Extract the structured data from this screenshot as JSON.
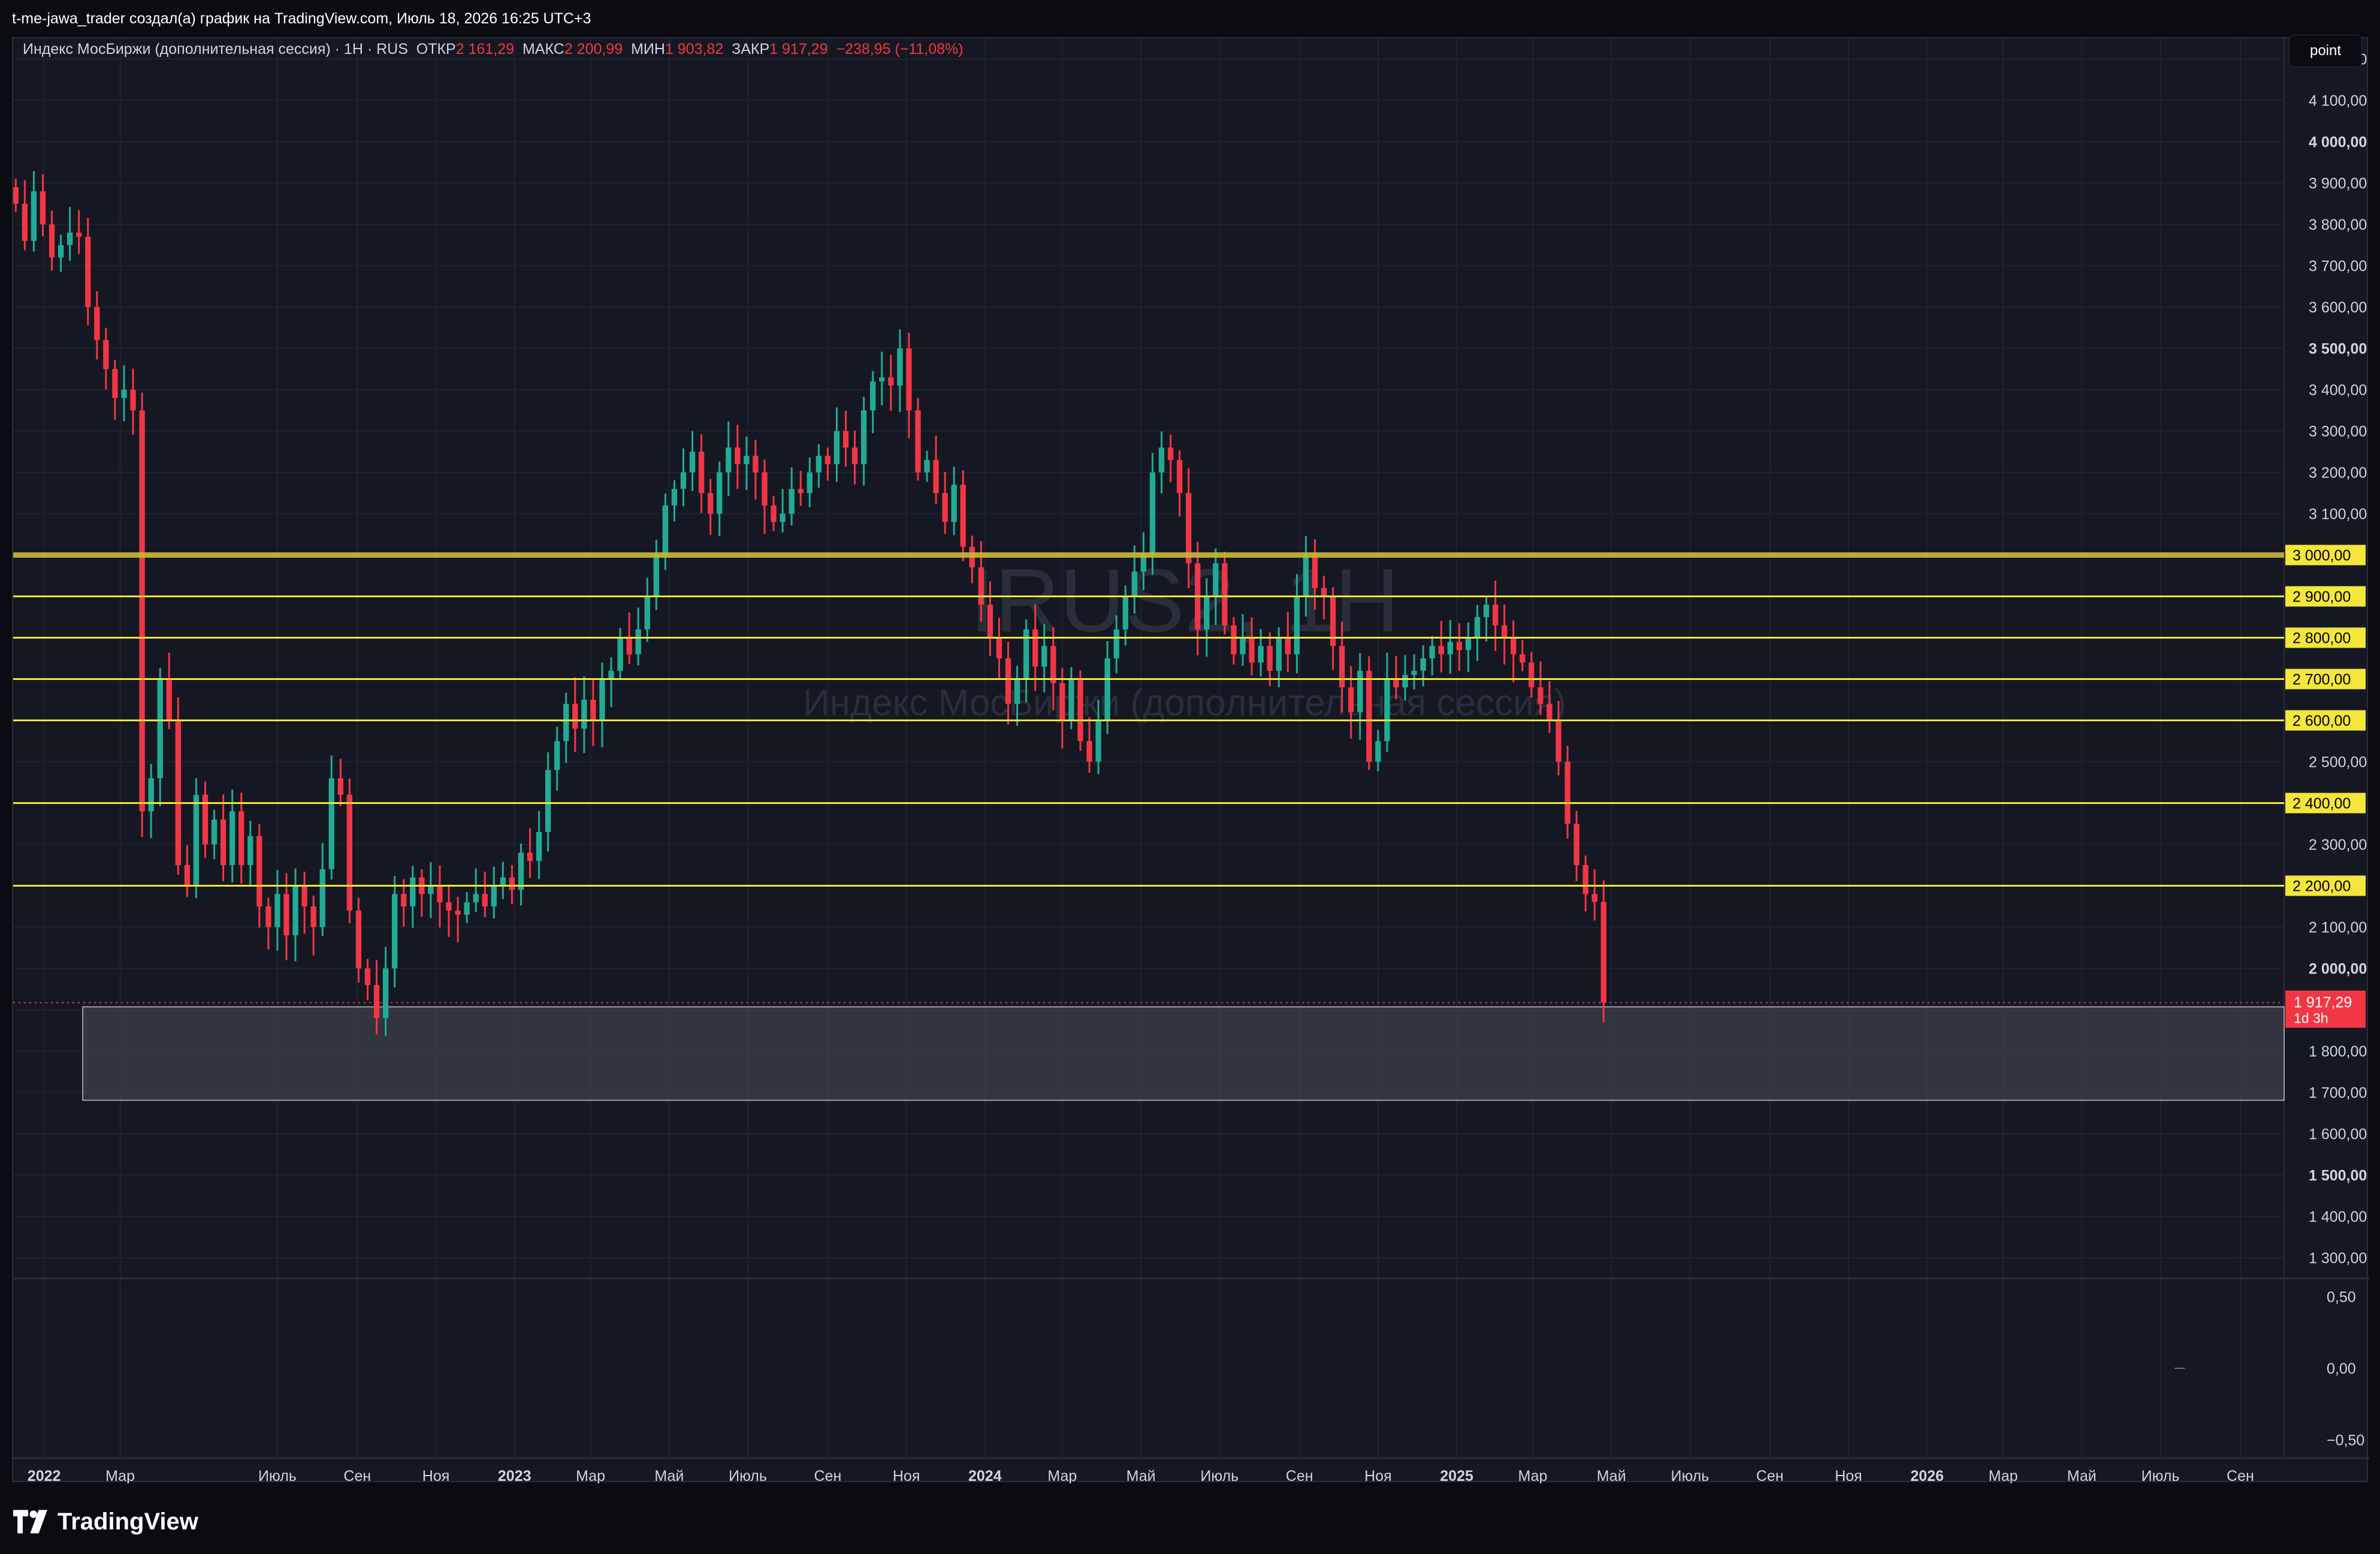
{
  "header": {
    "attribution": "t-me-jawa_trader создал(а) график на TradingView.com, Июль 18, 2026 16:25 UTC+3"
  },
  "legend": {
    "symbol": "Индекс МосБиржи (дополнительная сессия) · 1H · RUS",
    "open_label": "ОТКР",
    "open_value": "2 161,29",
    "high_label": "МАКС",
    "high_value": "2 200,99",
    "low_label": "МИН",
    "low_value": "1 903,82",
    "close_label": "ЗАКР",
    "close_value": "1 917,29",
    "change": "−238,95 (−11,08%)"
  },
  "toolbar": {
    "point_label": "point"
  },
  "watermark": {
    "ticker": "IRUS2, 1H",
    "name": "Индекс МосБиржи (дополнительная сессия)"
  },
  "footer": {
    "brand": "TradingView"
  },
  "colors": {
    "up": "#22ab94",
    "down": "#f23645",
    "level": "#f5e63b",
    "background": "#151822",
    "grid": "#1f2330",
    "zone": "#4a4d55"
  },
  "chart_data": {
    "type": "candlestick",
    "price_axis": {
      "range": [
        1250,
        4250
      ],
      "ticks": [
        {
          "v": 4200,
          "t": "4 200,00"
        },
        {
          "v": 4100,
          "t": "4 100,00"
        },
        {
          "v": 4000,
          "t": "4 000,00",
          "b": true
        },
        {
          "v": 3900,
          "t": "3 900,00"
        },
        {
          "v": 3800,
          "t": "3 800,00"
        },
        {
          "v": 3700,
          "t": "3 700,00"
        },
        {
          "v": 3600,
          "t": "3 600,00"
        },
        {
          "v": 3500,
          "t": "3 500,00",
          "b": true
        },
        {
          "v": 3400,
          "t": "3 400,00"
        },
        {
          "v": 3300,
          "t": "3 300,00"
        },
        {
          "v": 3200,
          "t": "3 200,00"
        },
        {
          "v": 3100,
          "t": "3 100,00"
        },
        {
          "v": 2500,
          "t": "2 500,00"
        },
        {
          "v": 2300,
          "t": "2 300,00"
        },
        {
          "v": 2100,
          "t": "2 100,00"
        },
        {
          "v": 2000,
          "t": "2 000,00",
          "b": true
        },
        {
          "v": 1800,
          "t": "1 800,00"
        },
        {
          "v": 1700,
          "t": "1 700,00"
        },
        {
          "v": 1600,
          "t": "1 600,00"
        },
        {
          "v": 1500,
          "t": "1 500,00",
          "b": true
        },
        {
          "v": 1400,
          "t": "1 400,00"
        },
        {
          "v": 1300,
          "t": "1 300,00"
        }
      ]
    },
    "levels": [
      {
        "value": 3000,
        "label": "3 000,00",
        "thick": true
      },
      {
        "value": 2900,
        "label": "2 900,00"
      },
      {
        "value": 2800,
        "label": "2 800,00"
      },
      {
        "value": 2700,
        "label": "2 700,00"
      },
      {
        "value": 2600,
        "label": "2 600,00"
      },
      {
        "value": 2400,
        "label": "2 400,00"
      },
      {
        "value": 2200,
        "label": "2 200,00"
      }
    ],
    "current_price": {
      "value": 1917.29,
      "label": "1 917,29",
      "countdown": "1d 3h"
    },
    "zone": {
      "from_date": "2022-01-31",
      "low": 1681,
      "high": 1907
    },
    "indicator": {
      "ticks": [
        {
          "v": 0.5,
          "t": "0,50"
        },
        {
          "v": 0.0,
          "t": "0,00"
        },
        {
          "v": -0.5,
          "t": "−0,50"
        }
      ],
      "range": [
        -0.62,
        0.62
      ]
    },
    "time_axis": {
      "start": "2021-12-08",
      "end": "2026-10-05",
      "labels": [
        {
          "d": "2022-01-01",
          "t": "2022",
          "b": true
        },
        {
          "d": "2022-03-01",
          "t": "Мар"
        },
        {
          "d": "2022-07-01",
          "t": "Июль"
        },
        {
          "d": "2022-09-01",
          "t": "Сен"
        },
        {
          "d": "2022-11-01",
          "t": "Ноя"
        },
        {
          "d": "2023-01-01",
          "t": "2023",
          "b": true
        },
        {
          "d": "2023-03-01",
          "t": "Мар"
        },
        {
          "d": "2023-05-01",
          "t": "Май"
        },
        {
          "d": "2023-07-01",
          "t": "Июль"
        },
        {
          "d": "2023-09-01",
          "t": "Сен"
        },
        {
          "d": "2023-11-01",
          "t": "Ноя"
        },
        {
          "d": "2024-01-01",
          "t": "2024",
          "b": true
        },
        {
          "d": "2024-03-01",
          "t": "Мар"
        },
        {
          "d": "2024-05-01",
          "t": "Май"
        },
        {
          "d": "2024-07-01",
          "t": "Июль"
        },
        {
          "d": "2024-09-01",
          "t": "Сен"
        },
        {
          "d": "2024-11-01",
          "t": "Ноя"
        },
        {
          "d": "2025-01-01",
          "t": "2025",
          "b": true
        },
        {
          "d": "2025-03-01",
          "t": "Мар"
        },
        {
          "d": "2025-05-01",
          "t": "Май"
        },
        {
          "d": "2025-07-01",
          "t": "Июль"
        },
        {
          "d": "2025-09-01",
          "t": "Сен"
        },
        {
          "d": "2025-11-01",
          "t": "Ноя"
        },
        {
          "d": "2026-01-01",
          "t": "2026",
          "b": true
        },
        {
          "d": "2026-03-01",
          "t": "Мар"
        },
        {
          "d": "2026-05-01",
          "t": "Май"
        },
        {
          "d": "2026-07-01",
          "t": "Июль"
        },
        {
          "d": "2026-09-01",
          "t": "Сен"
        }
      ]
    },
    "first_date": "2021-12-10",
    "candle_step_days": 7,
    "closes": [
      3850,
      3760,
      3880,
      3800,
      3720,
      3750,
      3780,
      3770,
      3600,
      3520,
      3450,
      3380,
      3400,
      3350,
      2380,
      2460,
      2700,
      2600,
      2250,
      2200,
      2420,
      2300,
      2360,
      2250,
      2380,
      2250,
      2320,
      2150,
      2100,
      2180,
      2080,
      2200,
      2150,
      2100,
      2240,
      2460,
      2420,
      2140,
      2000,
      1960,
      1880,
      2000,
      2180,
      2150,
      2220,
      2180,
      2200,
      2160,
      2140,
      2130,
      2160,
      2180,
      2150,
      2200,
      2220,
      2190,
      2280,
      2260,
      2330,
      2480,
      2550,
      2640,
      2580,
      2650,
      2600,
      2700,
      2720,
      2800,
      2760,
      2820,
      2900,
      3000,
      3120,
      3160,
      3200,
      3250,
      3150,
      3100,
      3200,
      3260,
      3220,
      3240,
      3200,
      3120,
      3080,
      3100,
      3160,
      3150,
      3200,
      3240,
      3220,
      3300,
      3260,
      3220,
      3350,
      3420,
      3430,
      3410,
      3500,
      3350,
      3200,
      3230,
      3150,
      3080,
      3170,
      3020,
      2970,
      2880,
      2800,
      2750,
      2640,
      2700,
      2820,
      2730,
      2780,
      2690,
      2600,
      2700,
      2550,
      2500,
      2600,
      2750,
      2820,
      2900,
      2960,
      3000,
      3200,
      3260,
      3230,
      3150,
      2980,
      2820,
      2900,
      2980,
      2830,
      2760,
      2800,
      2740,
      2780,
      2720,
      2800,
      2760,
      2900,
      3000,
      2920,
      2900,
      2780,
      2680,
      2620,
      2720,
      2500,
      2550,
      2700,
      2680,
      2710,
      2720,
      2750,
      2780,
      2760,
      2790,
      2770,
      2800,
      2850,
      2880,
      2830,
      2800,
      2760,
      2740,
      2680,
      2640,
      2600,
      2500,
      2350,
      2250,
      2180,
      2161,
      1917
    ],
    "notes": "Weekly-sampled OHLC approximation of the 1H IRUS2 series read off the price axis."
  }
}
